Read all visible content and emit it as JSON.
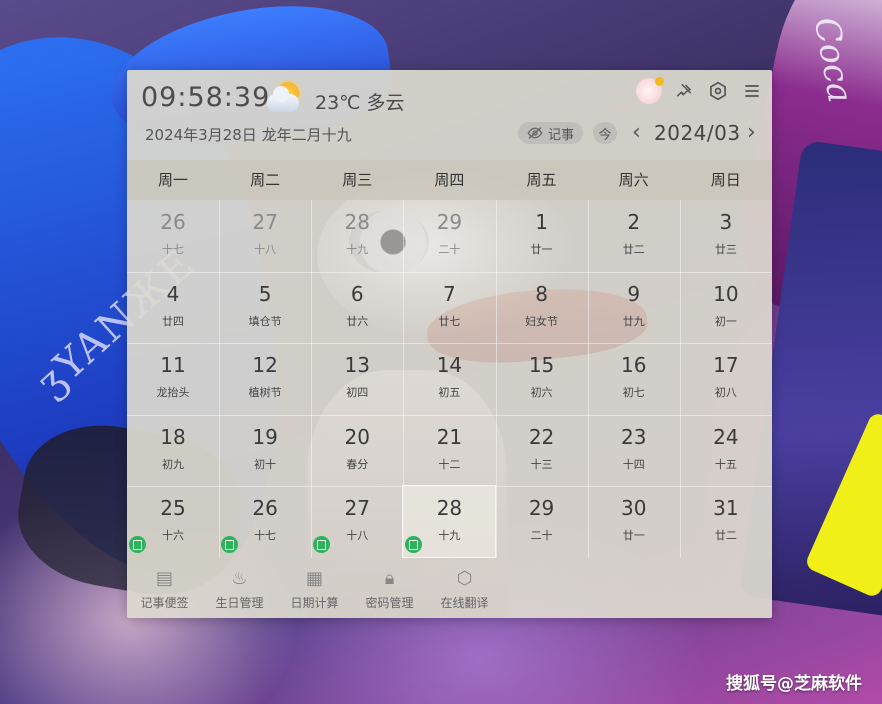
{
  "widget": {
    "time": "09:58:39",
    "weather": {
      "icon": "partly-cloudy-icon",
      "temp_desc": "23℃ 多云"
    },
    "date_line": "2024年3月28日 龙年二月十九",
    "note_toggle_label": "记事",
    "today_label": "今",
    "month_label": "2024/03",
    "prev_label": "‹",
    "next_label": "›",
    "top_icons": [
      "avatar",
      "pin-icon",
      "settings-icon",
      "menu-icon"
    ],
    "weekdays": [
      "周一",
      "周二",
      "周三",
      "周四",
      "周五",
      "周六",
      "周日"
    ],
    "weeks": [
      [
        {
          "day": "26",
          "lunar": "十七",
          "other": true
        },
        {
          "day": "27",
          "lunar": "十八",
          "other": true
        },
        {
          "day": "28",
          "lunar": "十九",
          "other": true
        },
        {
          "day": "29",
          "lunar": "二十",
          "other": true
        },
        {
          "day": "1",
          "lunar": "廿一"
        },
        {
          "day": "2",
          "lunar": "廿二"
        },
        {
          "day": "3",
          "lunar": "廿三"
        }
      ],
      [
        {
          "day": "4",
          "lunar": "廿四"
        },
        {
          "day": "5",
          "lunar": "填仓节"
        },
        {
          "day": "6",
          "lunar": "廿六"
        },
        {
          "day": "7",
          "lunar": "廿七"
        },
        {
          "day": "8",
          "lunar": "妇女节"
        },
        {
          "day": "9",
          "lunar": "廿九"
        },
        {
          "day": "10",
          "lunar": "初一"
        }
      ],
      [
        {
          "day": "11",
          "lunar": "龙抬头"
        },
        {
          "day": "12",
          "lunar": "植树节"
        },
        {
          "day": "13",
          "lunar": "初四"
        },
        {
          "day": "14",
          "lunar": "初五"
        },
        {
          "day": "15",
          "lunar": "初六"
        },
        {
          "day": "16",
          "lunar": "初七"
        },
        {
          "day": "17",
          "lunar": "初八"
        }
      ],
      [
        {
          "day": "18",
          "lunar": "初九"
        },
        {
          "day": "19",
          "lunar": "初十"
        },
        {
          "day": "20",
          "lunar": "春分"
        },
        {
          "day": "21",
          "lunar": "十二"
        },
        {
          "day": "22",
          "lunar": "十三"
        },
        {
          "day": "23",
          "lunar": "十四"
        },
        {
          "day": "24",
          "lunar": "十五"
        }
      ],
      [
        {
          "day": "25",
          "lunar": "十六",
          "note": true
        },
        {
          "day": "26",
          "lunar": "十七",
          "note": true
        },
        {
          "day": "27",
          "lunar": "十八",
          "note": true
        },
        {
          "day": "28",
          "lunar": "十九",
          "note": true,
          "today": true
        },
        {
          "day": "29",
          "lunar": "二十"
        },
        {
          "day": "30",
          "lunar": "廿一"
        },
        {
          "day": "31",
          "lunar": "廿二"
        }
      ]
    ],
    "tools": [
      {
        "label": "记事便签",
        "icon": "notepad-icon",
        "glyph": "▤"
      },
      {
        "label": "生日管理",
        "icon": "cake-icon",
        "glyph": "♨"
      },
      {
        "label": "日期计算",
        "icon": "calculator-icon",
        "glyph": "▦"
      },
      {
        "label": "密码管理",
        "icon": "lock-icon",
        "glyph": "🔒︎"
      },
      {
        "label": "在线翻译",
        "icon": "translate-icon",
        "glyph": "⬡"
      }
    ]
  },
  "watermark": "搜狐号@芝麻软件",
  "colors": {
    "note_badge": "#2db45a",
    "widget_bg": "#ddd9cf"
  }
}
